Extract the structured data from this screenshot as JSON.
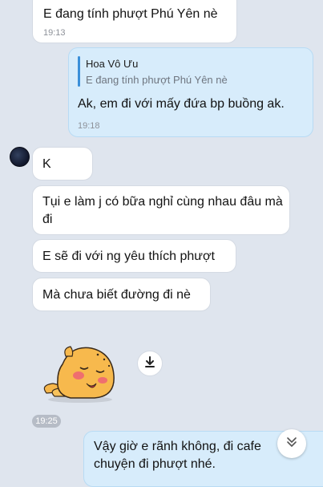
{
  "messages": [
    {
      "text": "E đang tính phượt Phú Yên nè",
      "time": "19:13"
    },
    {
      "quote_name": "Hoa Vô Ưu",
      "quote_text": "E đang tính phượt Phú Yên nè",
      "text": "Ak, em đi với mấy đứa bp buồng ak.",
      "time": "19:18"
    },
    {
      "text": "K"
    },
    {
      "text": "Tụi e làm j có bữa nghỉ cùng nhau đâu mà đi"
    },
    {
      "text": "E sẽ đi với ng yêu thích phượt"
    },
    {
      "text": "Mà chưa biết đường đi nè"
    },
    {
      "text": "Vậy giờ e rãnh không, đi cafe chuyện đi phượt nhé."
    }
  ],
  "sticker": {
    "icon": "bunny-sticker"
  },
  "time_separator": "19:25",
  "icons": {
    "avatar": "avatar",
    "download": "download-icon",
    "scroll": "chevron-double-down-icon"
  },
  "colors": {
    "background": "#dfe5ee",
    "incoming": "#ffffff",
    "outgoing": "#d7ecfb",
    "accent": "#3a8fd9"
  }
}
